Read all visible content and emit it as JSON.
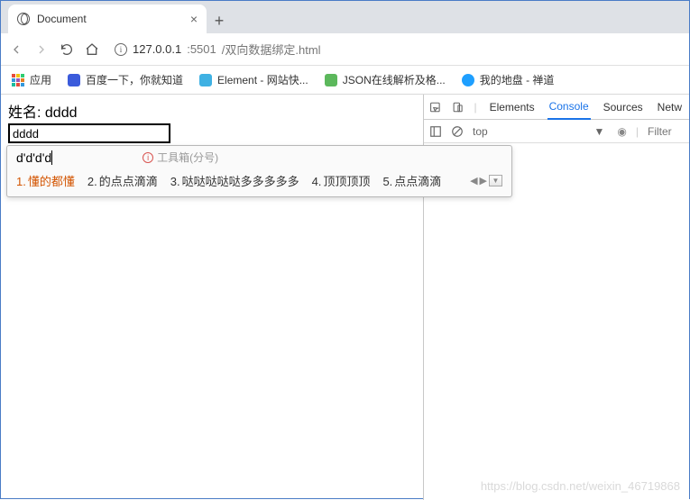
{
  "tab": {
    "title": "Document",
    "close": "×",
    "newtab": "+"
  },
  "url": {
    "host": "127.0.0.1",
    "port": ":5501",
    "path": "/双向数据绑定.html"
  },
  "bookmarks": {
    "apps": "应用",
    "items": [
      {
        "label": "百度一下，你就知道"
      },
      {
        "label": "Element - 网站快..."
      },
      {
        "label": "JSON在线解析及格..."
      },
      {
        "label": "我的地盘 - 禅道"
      }
    ]
  },
  "page": {
    "label_prefix": "姓名: ",
    "bound_value": "dddd",
    "input_value": "dddd"
  },
  "ime": {
    "composition": "d'd'd'd",
    "toolbox": "工具箱(分号)",
    "candidates": [
      {
        "n": "1.",
        "text": "懂的都懂"
      },
      {
        "n": "2.",
        "text": "的点点滴滴"
      },
      {
        "n": "3.",
        "text": "哒哒哒哒哒多多多多多"
      },
      {
        "n": "4.",
        "text": "顶顶顶顶"
      },
      {
        "n": "5.",
        "text": "点点滴滴"
      }
    ]
  },
  "devtools": {
    "tabs": {
      "elements": "Elements",
      "console": "Console",
      "sources": "Sources",
      "network": "Netw"
    },
    "context": "top",
    "filter_placeholder": "Filter"
  },
  "watermark": "https://blog.csdn.net/weixin_46719868"
}
